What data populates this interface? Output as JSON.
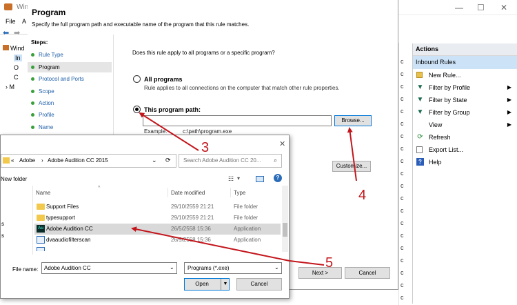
{
  "background_window": {
    "title": "Wind",
    "menu": [
      "File",
      "A"
    ],
    "tree_items": [
      "Wind",
      "In",
      "O",
      "C",
      "M"
    ],
    "middle_column_letters": [
      "",
      "c",
      "c",
      "c",
      "c",
      "c",
      "c",
      "c",
      "c",
      "c",
      "c",
      "c",
      "c",
      "c",
      "c",
      "c",
      "c",
      "c",
      "c",
      "c",
      "c"
    ]
  },
  "actions_pane": {
    "header": "Actions",
    "section": "Inbound Rules",
    "items": [
      {
        "label": "New Rule...",
        "icon": "new-rule-icon",
        "has_arrow": false
      },
      {
        "label": "Filter by Profile",
        "icon": "filter-icon",
        "has_arrow": true
      },
      {
        "label": "Filter by State",
        "icon": "filter-icon",
        "has_arrow": true
      },
      {
        "label": "Filter by Group",
        "icon": "filter-icon",
        "has_arrow": true
      },
      {
        "label": "View",
        "icon": "",
        "has_arrow": true
      },
      {
        "label": "Refresh",
        "icon": "refresh-icon",
        "has_arrow": false
      },
      {
        "label": "Export List...",
        "icon": "export-icon",
        "has_arrow": false
      },
      {
        "label": "Help",
        "icon": "help-icon",
        "has_arrow": false
      }
    ]
  },
  "wizard": {
    "title": "Program",
    "subtitle": "Specify the full program path and executable name of the program that this rule matches.",
    "steps_label": "Steps:",
    "steps": [
      {
        "label": "Rule Type",
        "active": false
      },
      {
        "label": "Program",
        "active": true
      },
      {
        "label": "Protocol and Ports",
        "active": false
      },
      {
        "label": "Scope",
        "active": false
      },
      {
        "label": "Action",
        "active": false
      },
      {
        "label": "Profile",
        "active": false
      },
      {
        "label": "Name",
        "active": false
      }
    ],
    "question": "Does this rule apply to all programs or a specific program?",
    "all_programs_label": "All programs",
    "all_programs_desc": "Rule applies to all connections on the computer that match other rule properties.",
    "this_program_label": "This program path:",
    "program_path_value": "",
    "browse_label": "Browse...",
    "example_label": "Example:",
    "example_value": "c:\\path\\program.exe",
    "customize_label": "Customize...",
    "next_label": "Next >",
    "cancel_label": "Cancel"
  },
  "file_dialog": {
    "breadcrumb": [
      "«",
      "Adobe",
      "Adobe Audition CC 2015"
    ],
    "search_placeholder": "Search Adobe Audition CC 20...",
    "new_folder_label": "New folder",
    "columns": {
      "name": "Name",
      "date": "Date modified",
      "type": "Type"
    },
    "rows": [
      {
        "name": "Support Files",
        "date": "29/10/2559 21:21",
        "type": "File folder",
        "icon": "folder",
        "selected": false
      },
      {
        "name": "typesupport",
        "date": "29/10/2559 21:21",
        "type": "File folder",
        "icon": "folder",
        "selected": false
      },
      {
        "name": "Adobe Audition CC",
        "date": "26/5/2558 15:36",
        "type": "Application",
        "icon": "audition",
        "selected": true
      },
      {
        "name": "dvaaudiofilterscan",
        "date": "26/5/2558 15:36",
        "type": "Application",
        "icon": "exe",
        "selected": false
      }
    ],
    "left_pane_letters": [
      "s",
      "s"
    ],
    "file_name_label": "File name:",
    "file_name_value": "Adobe Audition CC",
    "filter_value": "Programs (*.exe)",
    "open_label": "Open",
    "cancel_label": "Cancel"
  },
  "annotations": [
    "3",
    "4",
    "5"
  ],
  "colors": {
    "arrow": "#c3161c",
    "selection": "#cce2f7",
    "step_link": "#1f5fa8"
  }
}
